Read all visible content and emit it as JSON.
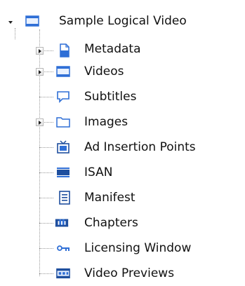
{
  "tree": {
    "root": {
      "label": "Sample Logical Video",
      "icon": "video-window-icon",
      "expanded": true
    },
    "items": [
      {
        "label": "Metadata",
        "icon": "document-icon",
        "expandable": true
      },
      {
        "label": "Videos",
        "icon": "video-window-icon",
        "expandable": true
      },
      {
        "label": "Subtitles",
        "icon": "speech-bubble-icon",
        "expandable": false
      },
      {
        "label": "Images",
        "icon": "folder-icon",
        "expandable": true
      },
      {
        "label": "Ad Insertion Points",
        "icon": "tv-icon",
        "expandable": false
      },
      {
        "label": "ISAN",
        "icon": "barcode-icon",
        "expandable": false
      },
      {
        "label": "Manifest",
        "icon": "list-icon",
        "expandable": false
      },
      {
        "label": "Chapters",
        "icon": "chapters-icon",
        "expandable": false
      },
      {
        "label": "Licensing Window",
        "icon": "key-icon",
        "expandable": false
      },
      {
        "label": "Video Previews",
        "icon": "filmstrip-icon",
        "expandable": false
      }
    ]
  },
  "colors": {
    "icon_blue": "#2f6fd6",
    "icon_dark": "#1f4f9e",
    "connector": "#9a9a9a"
  }
}
